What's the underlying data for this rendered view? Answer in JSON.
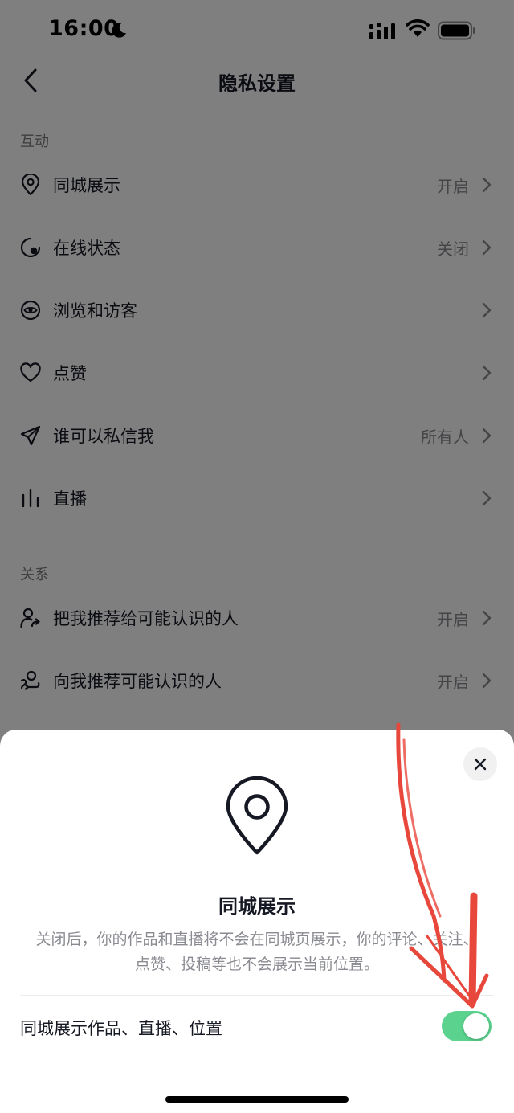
{
  "status_bar": {
    "time": "16:00"
  },
  "nav": {
    "title": "隐私设置"
  },
  "sections": {
    "interaction": {
      "header": "互动",
      "items": [
        {
          "label": "同城展示",
          "value": "开启"
        },
        {
          "label": "在线状态",
          "value": "关闭"
        },
        {
          "label": "浏览和访客",
          "value": ""
        },
        {
          "label": "点赞",
          "value": ""
        },
        {
          "label": "谁可以私信我",
          "value": "所有人"
        },
        {
          "label": "直播",
          "value": ""
        }
      ]
    },
    "relations": {
      "header": "关系",
      "items": [
        {
          "label": "把我推荐给可能认识的人",
          "value": "开启"
        },
        {
          "label": "向我推荐可能认识的人",
          "value": "开启"
        }
      ]
    }
  },
  "sheet": {
    "title": "同城展示",
    "description": "关闭后，你的作品和直播将不会在同城页展示，你的评论、关注、点赞、投稿等也不会展示当前位置。",
    "toggle_label": "同城展示作品、直播、位置",
    "toggle_on": true
  },
  "colors": {
    "toggle_on": "#5bd28d",
    "annotation": "#e8473c"
  },
  "icons": [
    "moon-icon",
    "signal-icon",
    "wifi-icon",
    "battery-icon",
    "back-icon",
    "location-pin-icon",
    "online-status-icon",
    "eye-icon",
    "heart-icon",
    "send-icon",
    "live-bars-icon",
    "user-share-icon",
    "user-swap-icon",
    "chevron-right-icon",
    "close-icon"
  ]
}
